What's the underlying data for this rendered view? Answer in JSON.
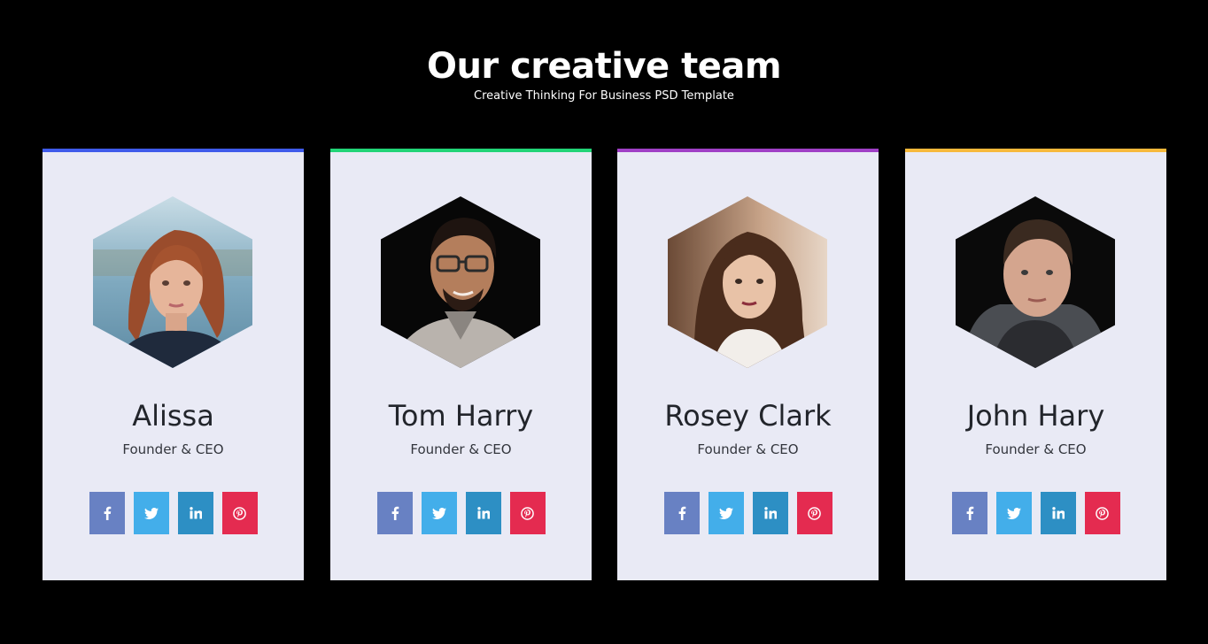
{
  "header": {
    "title": "Our creative team",
    "subtitle": "Creative Thinking For Business PSD Template"
  },
  "colors": {
    "card_background": "#e9eaf5",
    "facebook": "#6881c3",
    "twitter": "#43aeea",
    "linkedin": "#2d8fc4",
    "pinterest": "#e42b50"
  },
  "members": [
    {
      "name": "Alissa",
      "role": "Founder & CEO",
      "accent": "#3f5bea",
      "photo": "photo-woman-red-hair"
    },
    {
      "name": "Tom Harry",
      "role": "Founder & CEO",
      "accent": "#22d477",
      "photo": "photo-man-glasses"
    },
    {
      "name": "Rosey Clark",
      "role": "Founder & CEO",
      "accent": "#a040c6",
      "photo": "photo-woman-brown-hair"
    },
    {
      "name": "John Hary",
      "role": "Founder & CEO",
      "accent": "#f7b93b",
      "photo": "photo-man-hoodie"
    }
  ],
  "social_icons": [
    "facebook-icon",
    "twitter-icon",
    "linkedin-icon",
    "pinterest-icon"
  ]
}
